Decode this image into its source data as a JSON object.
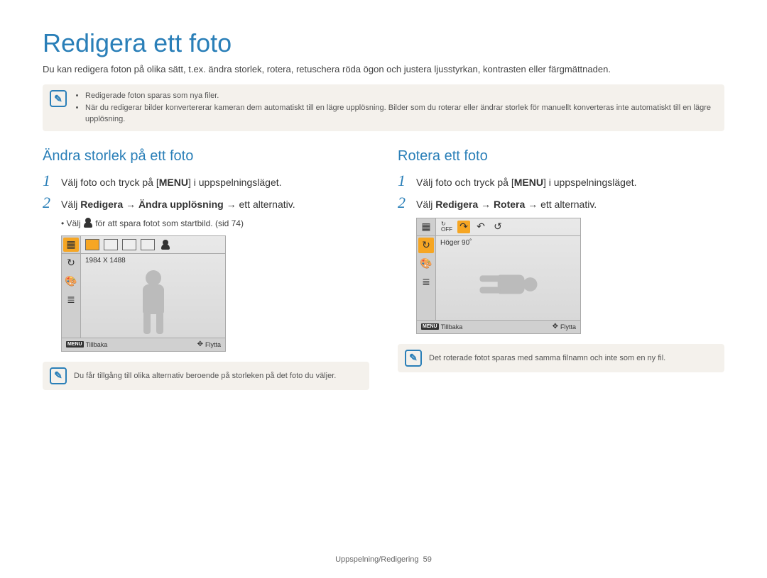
{
  "title": "Redigera ett foto",
  "intro": "Du kan redigera foton på olika sätt, t.ex. ändra storlek, rotera, retuschera röda ögon och justera ljusstyrkan, kontrasten eller färgmättnaden.",
  "top_note": {
    "items": [
      "Redigerade foton sparas som nya filer.",
      "När du redigerar bilder konvertererar kameran dem automatiskt till en lägre upplösning. Bilder som du roterar eller ändrar storlek för manuellt konverteras inte automatiskt till en lägre upplösning."
    ]
  },
  "left": {
    "heading": "Ändra storlek på ett foto",
    "step1_prefix": "Välj foto och tryck på [",
    "step1_key": "MENU",
    "step1_suffix": "] i uppspelningsläget.",
    "step2_prefix": "Välj ",
    "step2_bold1": "Redigera",
    "step2_arrow": " → ",
    "step2_bold2": "Ändra upplösning",
    "step2_suffix": " → ett alternativ.",
    "substep_prefix": "Välj ",
    "substep_suffix": " för att spara fotot som startbild. (sid 74)",
    "cam_label": "1984 X 1488",
    "cam_back": "Tillbaka",
    "cam_move": "Flytta",
    "note": "Du får tillgång till olika alternativ beroende på storleken på det foto du väljer."
  },
  "right": {
    "heading": "Rotera ett foto",
    "step1_prefix": "Välj foto och tryck på [",
    "step1_key": "MENU",
    "step1_suffix": "] i uppspelningsläget.",
    "step2_prefix": "Välj ",
    "step2_bold1": "Redigera",
    "step2_arrow": " → ",
    "step2_bold2": "Rotera",
    "step2_suffix": " → ett alternativ.",
    "cam_label": "Höger 90˚",
    "cam_back": "Tillbaka",
    "cam_move": "Flytta",
    "note": "Det roterade fotot sparas med samma filnamn och inte som en ny fil."
  },
  "footer": {
    "section": "Uppspelning/Redigering",
    "page": "59"
  }
}
